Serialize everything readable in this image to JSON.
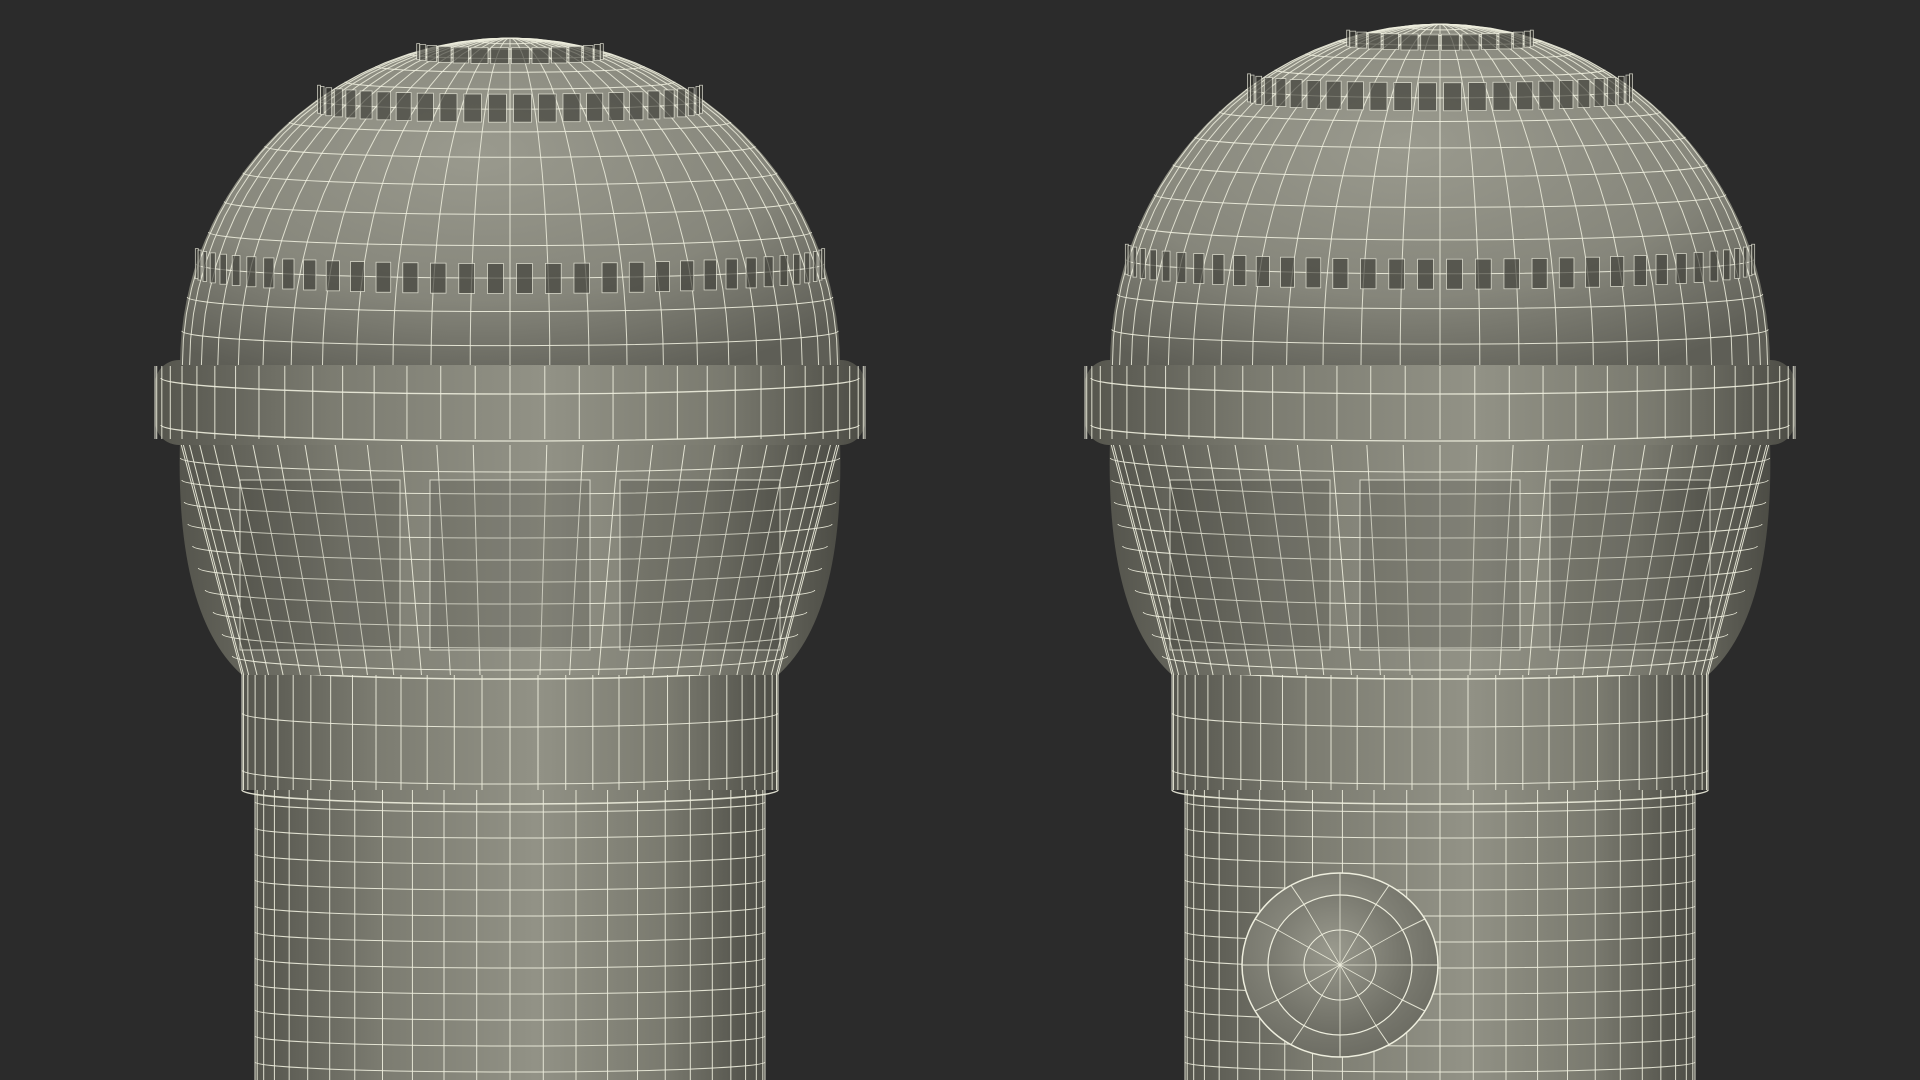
{
  "scene": {
    "background_color": "#2b2b2b",
    "material_color": "#8b8b7f",
    "wire_color": "#eeeede",
    "models": [
      {
        "name": "microphone-left",
        "has_button": false
      },
      {
        "name": "microphone-right",
        "has_button": true
      }
    ]
  }
}
